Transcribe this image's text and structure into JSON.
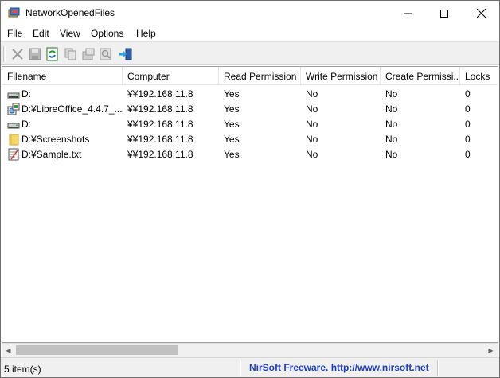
{
  "window": {
    "title": "NetworkOpenedFiles",
    "controls": {
      "minimize_icon": "minimize-icon",
      "maximize_icon": "maximize-icon",
      "close_icon": "close-icon"
    }
  },
  "menu": [
    "File",
    "Edit",
    "View",
    "Options",
    "Help"
  ],
  "toolbar": {
    "buttons": [
      {
        "icon": "close-files-icon"
      },
      {
        "icon": "save-icon"
      },
      {
        "icon": "refresh-icon"
      },
      {
        "icon": "copy-icon"
      },
      {
        "icon": "properties-icon"
      },
      {
        "icon": "find-icon"
      },
      {
        "icon": "exit-icon"
      }
    ]
  },
  "columns": [
    "Filename",
    "Computer",
    "Read Permission",
    "Write Permission",
    "Create Permissi...",
    "Locks"
  ],
  "rows": [
    {
      "icon": "drive-icon",
      "filename": "D:",
      "computer": "¥¥192.168.11.8",
      "read": "Yes",
      "write": "No",
      "create": "No",
      "locks": "0"
    },
    {
      "icon": "installer-icon",
      "filename": "D:¥LibreOffice_4.4.7_...",
      "computer": "¥¥192.168.11.8",
      "read": "Yes",
      "write": "No",
      "create": "No",
      "locks": "0"
    },
    {
      "icon": "drive-icon",
      "filename": "D:",
      "computer": "¥¥192.168.11.8",
      "read": "Yes",
      "write": "No",
      "create": "No",
      "locks": "0"
    },
    {
      "icon": "folder-icon",
      "filename": "D:¥Screenshots",
      "computer": "¥¥192.168.11.8",
      "read": "Yes",
      "write": "No",
      "create": "No",
      "locks": "0"
    },
    {
      "icon": "text-file-icon",
      "filename": "D:¥Sample.txt",
      "computer": "¥¥192.168.11.8",
      "read": "Yes",
      "write": "No",
      "create": "No",
      "locks": "0"
    }
  ],
  "status": {
    "count": "5 item(s)",
    "link": "NirSoft Freeware.  http://www.nirsoft.net"
  },
  "colors": {
    "link": "#1f3fbf",
    "toolbar_bg": "#f0f0f0"
  }
}
